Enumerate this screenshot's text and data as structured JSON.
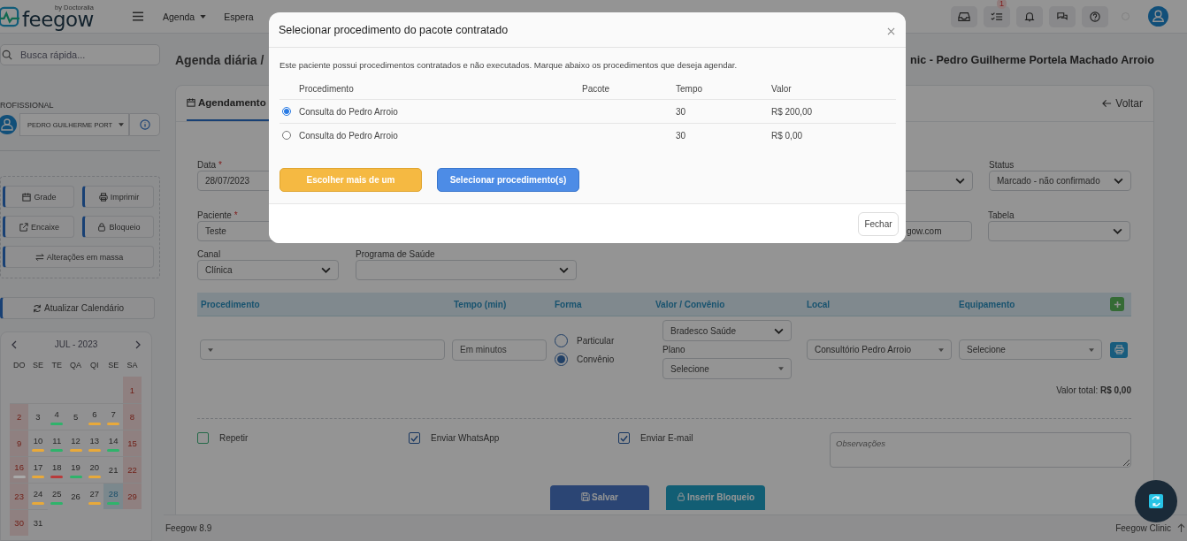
{
  "topbar": {
    "brand": "feegow",
    "brand_tagline": "by Doctoralia",
    "menu": [
      {
        "label": "Agenda",
        "has_caret": true
      },
      {
        "label": "Espera",
        "has_caret": false
      }
    ],
    "tasks_badge": "1"
  },
  "sidebar": {
    "search": {
      "placeholder": "Busca rápida..."
    },
    "professional_label": "ROFISSIONAL",
    "professional": "PEDRO GUILHERME PORT",
    "actions": [
      {
        "label": "Grade",
        "kind": "calendar"
      },
      {
        "label": "Imprimir",
        "kind": "print"
      },
      {
        "label": "Encaixe",
        "kind": "external"
      },
      {
        "label": "Bloqueio",
        "kind": "lock"
      },
      {
        "label": "Alterações em massa",
        "kind": "swap"
      }
    ],
    "refresh": "Atualizar Calendário",
    "calendar": {
      "month": "JUL - 2023",
      "weekdays": [
        "DO",
        "SE",
        "TE",
        "QA",
        "QI",
        "SE",
        "SA"
      ],
      "weeks": [
        [
          {
            "day": "1",
            "selected": false
          }
        ],
        [
          {
            "day": "2",
            "selected": false
          },
          {
            "day": "3",
            "selected": false
          },
          {
            "day": "4",
            "selected": false,
            "color": "#2fb36b"
          },
          {
            "day": "5",
            "selected": false
          },
          {
            "day": "6",
            "selected": false,
            "color": "#e8a93a"
          },
          {
            "day": "7",
            "selected": false,
            "color": "#e8a93a"
          },
          {
            "day": "8",
            "selected": false
          }
        ],
        [
          {
            "day": "9",
            "selected": false
          },
          {
            "day": "10",
            "selected": false,
            "color": "#e8a93a"
          },
          {
            "day": "11",
            "selected": false,
            "color": "#2fb36b"
          },
          {
            "day": "12",
            "selected": false,
            "color": "#e8a93a"
          },
          {
            "day": "13",
            "selected": false,
            "color": "#e8a93a"
          },
          {
            "day": "14",
            "selected": false,
            "color": "#2fb36b"
          },
          {
            "day": "15",
            "selected": false
          }
        ],
        [
          {
            "day": "16",
            "selected": false,
            "color": "#a9a9a9"
          },
          {
            "day": "17",
            "selected": false,
            "color": "#e8a93a"
          },
          {
            "day": "18",
            "selected": false,
            "color": "#b83b3b"
          },
          {
            "day": "19",
            "selected": false,
            "color": "#2fb36b"
          },
          {
            "day": "20",
            "selected": false,
            "color": "#e8a93a"
          },
          {
            "day": "21",
            "selected": false
          },
          {
            "day": "22",
            "selected": false
          }
        ],
        [
          {
            "day": "23",
            "selected": false
          },
          {
            "day": "24",
            "selected": false,
            "color": "#e8a93a"
          },
          {
            "day": "25",
            "selected": false,
            "color": "#2fb36b"
          },
          {
            "day": "26",
            "selected": false
          },
          {
            "day": "27",
            "selected": false,
            "color": "#e8a93a"
          },
          {
            "day": "28",
            "selected": true,
            "color": "#2fb36b"
          },
          {
            "day": "29",
            "selected": false
          }
        ],
        [
          {
            "day": "30",
            "selected": false
          },
          {
            "day": "31",
            "selected": false
          }
        ]
      ]
    }
  },
  "main": {
    "breadcrumb": "Agenda diária /",
    "title": "nic - Pedro Guilherme Portela Machado Arroio",
    "tabs": [
      {
        "label": "Agendamento",
        "selected": true
      }
    ],
    "back": "Voltar",
    "form": {
      "required_mark": "*",
      "date": {
        "label": "Data",
        "required": true,
        "value": "28/07/2023"
      },
      "status": {
        "label": "Status",
        "value": "Marcado - não confirmado"
      },
      "patient": {
        "label": "Paciente",
        "required": true,
        "value": "Teste"
      },
      "email_fragment": "gow.com",
      "table_field": {
        "label": "Tabela"
      },
      "channel": {
        "label": "Canal",
        "value": "Clínica"
      },
      "health_program": {
        "label": "Programa de Saúde"
      }
    },
    "procedures": {
      "columns": [
        "Procedimento",
        "Tempo (min)",
        "Forma",
        "Valor / Convênio",
        "Local",
        "Equipamento"
      ],
      "time_placeholder": "Em minutos",
      "payment_types": [
        {
          "label": "Particular",
          "selected": false
        },
        {
          "label": "Convênio",
          "selected": true
        }
      ],
      "insurer": "Bradesco Saúde",
      "plan_label": "Plano",
      "plan": "Selecione",
      "location": "Consultório Pedro Arroio",
      "equipment": "Selecione",
      "total": "Valor total: **R$ 0,00**"
    },
    "options": [
      {
        "label": "Repetir",
        "checked": false
      },
      {
        "label": "Enviar WhatsApp",
        "checked": true
      },
      {
        "label": "Enviar E-mail",
        "checked": true
      }
    ],
    "notes_placeholder": "Observações",
    "actions": [
      {
        "label": "Salvar",
        "kind": "save"
      },
      {
        "label": "Inserir Bloqueio",
        "kind": "block"
      }
    ]
  },
  "footer": {
    "version": "Feegow 8.9",
    "product": "Feegow Clinic"
  },
  "modal": {
    "title": "Selecionar procedimento do pacote contratado",
    "intro": "Este paciente possui procedimentos contratados e não executados. Marque abaixo os procedimentos que deseja agendar.",
    "columns": [
      "Procedimento",
      "Pacote",
      "Tempo",
      "Valor"
    ],
    "rows": [
      {
        "procedure": "Consulta do Pedro Arroio",
        "time": "30",
        "value": "R$ 200,00",
        "selected": true
      },
      {
        "procedure": "Consulta do Pedro Arroio",
        "time": "30",
        "value": "R$ 0,00",
        "selected": false
      }
    ],
    "buttons": [
      {
        "label": "Escolher mais de um",
        "kind": "warning"
      },
      {
        "label": "Selecionar procedimento(s)",
        "kind": "primary"
      }
    ],
    "close_button": "Fechar"
  }
}
